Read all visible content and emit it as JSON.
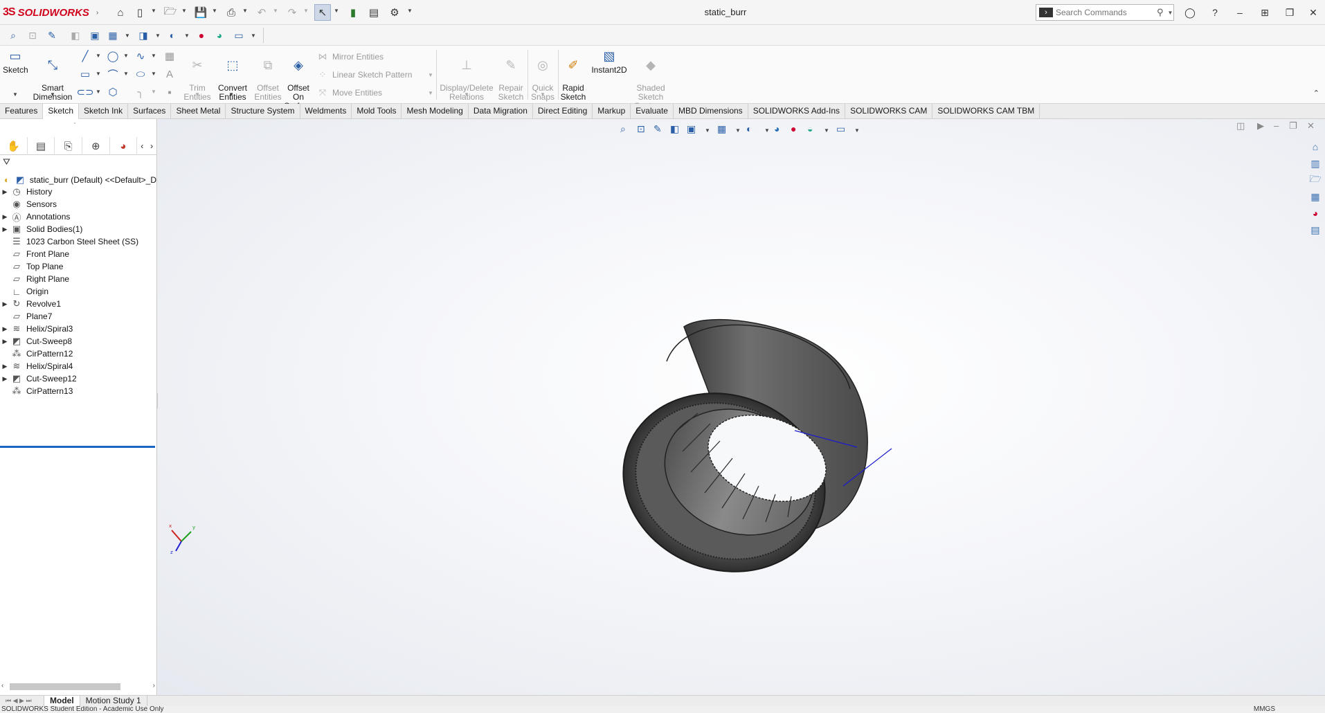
{
  "app": {
    "brand": "SOLIDWORKS",
    "document_title": "static_burr",
    "search_placeholder": "Search Commands"
  },
  "ribbon": {
    "sketch": "Sketch",
    "smart_dimension": "Smart\nDimension",
    "trim_entities": "Trim\nEntities",
    "convert_entities": "Convert\nEntities",
    "offset_entities": "Offset\nEntities",
    "offset_on_surface": "Offset\nOn\nSurface",
    "mirror_entities": "Mirror Entities",
    "linear_sketch_pattern": "Linear Sketch Pattern",
    "move_entities": "Move Entities",
    "display_delete_relations": "Display/Delete\nRelations",
    "repair_sketch": "Repair\nSketch",
    "quick_snaps": "Quick\nSnaps",
    "rapid_sketch": "Rapid\nSketch",
    "instant2d": "Instant2D",
    "shaded_sketch_contours": "Shaded\nSketch\nContours"
  },
  "tabs": [
    "Features",
    "Sketch",
    "Sketch Ink",
    "Surfaces",
    "Sheet Metal",
    "Structure System",
    "Weldments",
    "Mold Tools",
    "Mesh Modeling",
    "Data Migration",
    "Direct Editing",
    "Markup",
    "Evaluate",
    "MBD Dimensions",
    "SOLIDWORKS Add-Ins",
    "SOLIDWORKS CAM",
    "SOLIDWORKS CAM TBM"
  ],
  "active_tab": "Sketch",
  "feature_tree": {
    "root": "static_burr (Default) <<Default>_D",
    "items": [
      {
        "label": "History",
        "expandable": true,
        "icon": "history-icon"
      },
      {
        "label": "Sensors",
        "expandable": false,
        "icon": "sensor-icon"
      },
      {
        "label": "Annotations",
        "expandable": true,
        "icon": "annotation-icon"
      },
      {
        "label": "Solid Bodies(1)",
        "expandable": true,
        "icon": "solid-bodies-icon"
      },
      {
        "label": "1023 Carbon Steel Sheet (SS)",
        "expandable": false,
        "icon": "material-icon"
      },
      {
        "label": "Front Plane",
        "expandable": false,
        "icon": "plane-icon"
      },
      {
        "label": "Top Plane",
        "expandable": false,
        "icon": "plane-icon"
      },
      {
        "label": "Right Plane",
        "expandable": false,
        "icon": "plane-icon"
      },
      {
        "label": "Origin",
        "expandable": false,
        "icon": "origin-icon"
      },
      {
        "label": "Revolve1",
        "expandable": true,
        "icon": "revolve-icon"
      },
      {
        "label": "Plane7",
        "expandable": false,
        "icon": "plane-icon"
      },
      {
        "label": "Helix/Spiral3",
        "expandable": true,
        "icon": "helix-icon"
      },
      {
        "label": "Cut-Sweep8",
        "expandable": true,
        "icon": "cut-sweep-icon"
      },
      {
        "label": "CirPattern12",
        "expandable": false,
        "icon": "circular-pattern-icon"
      },
      {
        "label": "Helix/Spiral4",
        "expandable": true,
        "icon": "helix-icon"
      },
      {
        "label": "Cut-Sweep12",
        "expandable": true,
        "icon": "cut-sweep-icon"
      },
      {
        "label": "CirPattern13",
        "expandable": false,
        "icon": "circular-pattern-icon"
      }
    ]
  },
  "bottom_tabs": [
    "Model",
    "Motion Study 1"
  ],
  "status": {
    "left": "SOLIDWORKS Student Edition - Academic Use Only",
    "right": "MMGS"
  },
  "colors": {
    "brand_red": "#d0021b",
    "accent_blue": "#2a5fa8",
    "rollback_bar": "#1a66c4"
  }
}
